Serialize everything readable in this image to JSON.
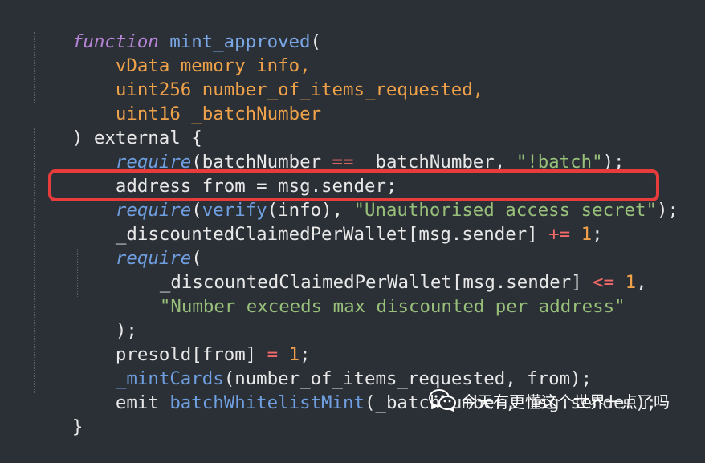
{
  "code": {
    "l1": [
      "function",
      " ",
      "mint_approved",
      "("
    ],
    "l2": [
      "vData memory info,"
    ],
    "l3": [
      "uint256 number_of_items_requested,"
    ],
    "l4": [
      "uint16 _batchNumber"
    ],
    "l5": [
      ") external {"
    ],
    "l6": [
      "require",
      "(batchNumber ",
      "==",
      " _batchNumber, ",
      "\"!batch\"",
      ");"
    ],
    "l7": [
      "address from = msg.sender;"
    ],
    "l8": [
      "require",
      "(",
      "verify",
      "(info), ",
      "\"Unauthorised access secret\"",
      ");"
    ],
    "l9": [
      "_discountedClaimedPerWallet[msg.sender] ",
      "+=",
      " ",
      "1",
      ";"
    ],
    "l10": [
      "require",
      "("
    ],
    "l11": [
      "_discountedClaimedPerWallet[msg.sender] ",
      "<=",
      " ",
      "1",
      ","
    ],
    "l12": [
      "\"Number exceeds max discounted per address\""
    ],
    "l13": [
      ");"
    ],
    "l14": [
      "presold[from] ",
      "=",
      " ",
      "1",
      ";"
    ],
    "l15": [
      "_mintCards",
      "(number_of_items_requested, from);"
    ],
    "l16": [
      "emit ",
      "batchWhitelistMint",
      "(_batchNumber, msg.sender);"
    ],
    "l17": [
      "}"
    ]
  },
  "watermark": {
    "icon": "wechat-icon",
    "text": "今天有更懂这个世界一点了吗"
  },
  "colors": {
    "background": "#2b3036",
    "keyword": "#b784d8",
    "function_name": "#7aa7e6",
    "type": "#f0a24a",
    "string": "#98c07a",
    "operator": "#f46a6a",
    "highlight_border": "#e83b3b"
  }
}
